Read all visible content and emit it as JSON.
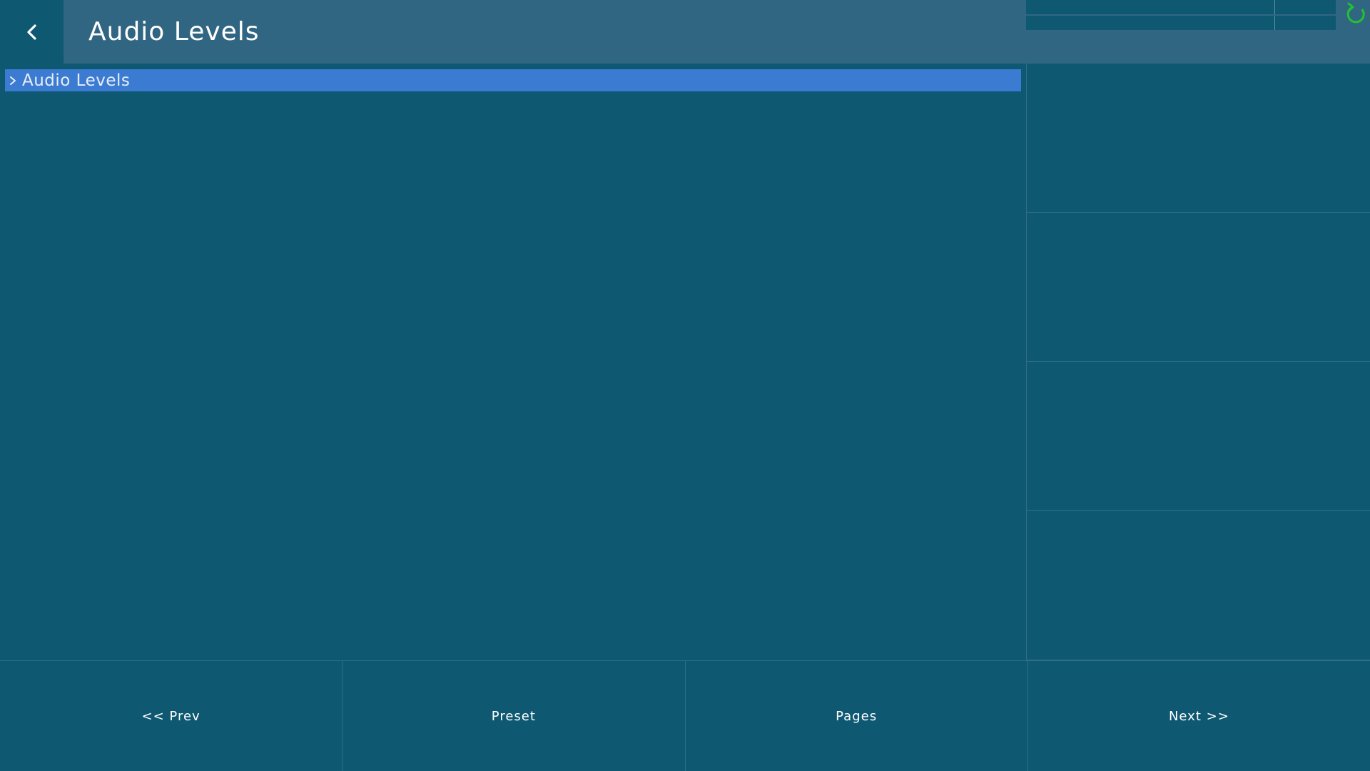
{
  "header": {
    "title": "Audio Levels",
    "back_icon": "chevron-left-icon",
    "refresh_icon": "refresh-icon"
  },
  "list": {
    "items": [
      {
        "label": "Audio Levels",
        "selected": true,
        "icon": "chevron-right-icon"
      }
    ]
  },
  "bottom_nav": {
    "prev_label": "<< Prev",
    "preset_label": "Preset",
    "pages_label": "Pages",
    "next_label": "Next >>"
  },
  "colors": {
    "background": "#0f5872",
    "header": "#316683",
    "selected_item": "#3b7bd2",
    "refresh_accent": "#22c22e",
    "text": "#ffffff"
  }
}
